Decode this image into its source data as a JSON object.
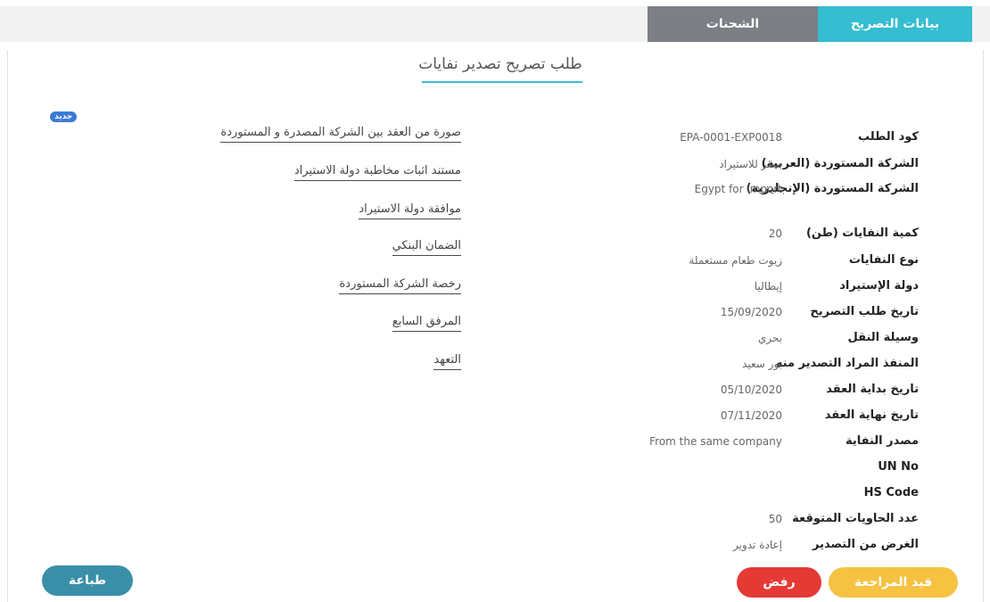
{
  "tabs": {
    "active": "بيانات التصريح",
    "inactive": "الشحنات"
  },
  "title": "طلب تصريح تصدير نفايات",
  "badge": "جديد",
  "details": [
    {
      "label": "كود الطلب",
      "value": "EPA-0001-EXP0018"
    },
    {
      "label": "الشركة المستوردة (العربية)",
      "value": "مصر للاستيراد"
    },
    {
      "label": "الشركة المستوردة (الإنجليزية)",
      "value": "Egypt for import"
    },
    {
      "label": "كمية النفايات (طن)",
      "value": "20"
    },
    {
      "label": "نوع النفايات",
      "value": "زيوت طعام مستعملة"
    },
    {
      "label": "دولة الإستيراد",
      "value": "إيطاليا"
    },
    {
      "label": "تاريخ طلب التصريح",
      "value": "15/09/2020"
    },
    {
      "label": "وسيلة النقل",
      "value": "بحري"
    },
    {
      "label": "المنفذ المراد التصدير منه",
      "value": "بور سعيد"
    },
    {
      "label": "تاريخ بداية العقد",
      "value": "05/10/2020"
    },
    {
      "label": "تاريخ نهاية العقد",
      "value": "07/11/2020"
    },
    {
      "label": "مصدر النفاية",
      "value": "From the same company"
    },
    {
      "label": "UN No",
      "value": ""
    },
    {
      "label": "HS Code",
      "value": ""
    },
    {
      "label": "عدد الحاويات المتوقعة",
      "value": "50"
    },
    {
      "label": "الغرض من التصدير",
      "value": "إعادة تدوير"
    }
  ],
  "attachments": [
    "صورة من العقد بين الشركة المصدرة و المستوردة",
    "مستند اثبات مخاطبة دولة الاستيراد",
    "موافقة دولة الاستيراد",
    "الضمان البنكي",
    "رخصة الشركة المستوردة",
    "المرفق السابع",
    "التعهد"
  ],
  "buttons": {
    "review": "قيد المراجعة",
    "reject": "رفض",
    "print": "طباعة"
  }
}
